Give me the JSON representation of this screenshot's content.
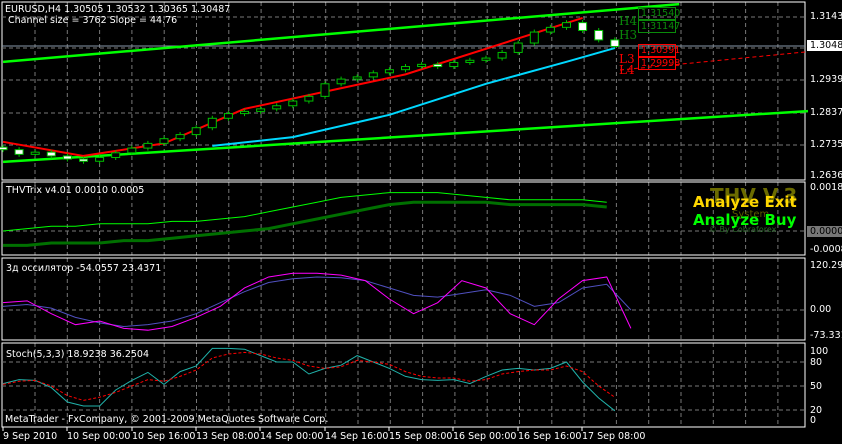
{
  "header": {
    "symbol_line": "EURUSD,H4  1.30505 1.30532 1.30365 1.30487",
    "channel_line": "Channel size = 3762 Slope = 44.76"
  },
  "price_axis": [
    "1.31430",
    "1.29390",
    "1.28370",
    "1.27350",
    "1.26360"
  ],
  "current_price": "1.30487",
  "levels": {
    "boxes": [
      "1.31540",
      "1.31147",
      "1.30391",
      "1.29998"
    ],
    "labels": [
      "H4",
      "H3",
      "L3",
      "L4"
    ]
  },
  "trix": {
    "title": "THVTrix v4.01 0.0010 0.0005",
    "axis": [
      "0.0018",
      "0.0000",
      "-0.0008"
    ],
    "logo": "THV V.3",
    "logo_sub": "System",
    "logo_credit": "© By Cobraforex",
    "signal_exit": "Analyze Exit",
    "signal_buy": "Analyze Buy"
  },
  "osc": {
    "title": "3д оссилятор -54.0557 23.4371",
    "axis": [
      "120.294",
      "0.00",
      "-73.3315"
    ]
  },
  "stoch": {
    "title": "Stoch(5,3,3) 18.9238 36.2504",
    "axis": [
      "100",
      "80",
      "50",
      "20",
      "0"
    ],
    "copyright": "MetaTrader - FxCompany, © 2001-2009 MetaQuotes Software Corp."
  },
  "time_axis": [
    "9 Sep 2010",
    "10 Sep 00:00",
    "10 Sep 16:00",
    "13 Sep 08:00",
    "14 Sep 00:00",
    "14 Sep 16:00",
    "15 Sep 08:00",
    "16 Sep 00:00",
    "16 Sep 16:00",
    "17 Sep 08:00"
  ],
  "colors": {
    "channel": "#00ff00",
    "ma": "#00d8ff",
    "trend": "#ff0000",
    "trix_fast": "#00ff00",
    "trix_slow": "#007000",
    "osc_a": "#ff00ff",
    "osc_b": "#5050c0",
    "stoch_main": "#20b2aa",
    "stoch_signal": "#ff0000"
  },
  "chart_data": [
    {
      "type": "candlestick",
      "title": "EURUSD,H4",
      "ylim": [
        1.2636,
        1.3143
      ],
      "close": [
        1.272,
        1.2705,
        1.2712,
        1.27,
        1.269,
        1.2683,
        1.2695,
        1.271,
        1.2725,
        1.274,
        1.2755,
        1.2768,
        1.279,
        1.282,
        1.2835,
        1.2842,
        1.285,
        1.286,
        1.2875,
        1.289,
        1.293,
        1.2945,
        1.2952,
        1.2965,
        1.2975,
        1.2985,
        1.2992,
        1.2985,
        1.2998,
        1.3005,
        1.3012,
        1.303,
        1.306,
        1.3095,
        1.311,
        1.3125,
        1.31,
        1.307,
        1.3049
      ],
      "channel_upper": [
        [
          0,
          1.3
        ],
        [
          42,
          1.3184
        ]
      ],
      "channel_lower": [
        [
          0,
          1.2681
        ],
        [
          50,
          1.2843
        ]
      ],
      "ma": [
        [
          13,
          1.2732
        ],
        [
          18,
          1.276
        ],
        [
          24,
          1.2831
        ],
        [
          30,
          1.293
        ],
        [
          35,
          1.3
        ],
        [
          38,
          1.3044
        ]
      ],
      "trend": [
        [
          0,
          1.2745
        ],
        [
          5,
          1.27
        ],
        [
          10,
          1.274
        ],
        [
          15,
          1.285
        ],
        [
          25,
          1.296
        ],
        [
          36,
          1.314
        ]
      ]
    },
    {
      "type": "line",
      "title": "THVTrix",
      "ylim": [
        -0.0008,
        0.0018
      ],
      "fast": [
        0.0,
        0.0001,
        0.0002,
        0.0002,
        0.0003,
        0.0003,
        0.0003,
        0.0004,
        0.0004,
        0.0005,
        0.0006,
        0.0008,
        0.001,
        0.0012,
        0.0014,
        0.0015,
        0.0016,
        0.0016,
        0.0016,
        0.0015,
        0.0014,
        0.0013,
        0.0013,
        0.0013,
        0.0013,
        0.0012
      ],
      "slow": [
        -0.0006,
        -0.0006,
        -0.0005,
        -0.0005,
        -0.0005,
        -0.0004,
        -0.0004,
        -0.0003,
        -0.0002,
        -0.0001,
        0.0,
        0.0001,
        0.0003,
        0.0005,
        0.0007,
        0.0009,
        0.0011,
        0.0012,
        0.0012,
        0.0012,
        0.0012,
        0.0011,
        0.0011,
        0.0011,
        0.0011,
        0.001
      ]
    },
    {
      "type": "line",
      "title": "3d oscillator",
      "ylim": [
        -73.3315,
        120.294
      ],
      "a": [
        20,
        25,
        -10,
        -40,
        -30,
        -50,
        -55,
        -45,
        -20,
        10,
        60,
        90,
        100,
        100,
        95,
        80,
        30,
        -10,
        20,
        80,
        60,
        -10,
        -40,
        30,
        80,
        90,
        -50
      ],
      "b": [
        10,
        15,
        5,
        -20,
        -35,
        -45,
        -40,
        -30,
        -10,
        20,
        50,
        75,
        85,
        90,
        88,
        80,
        60,
        40,
        35,
        45,
        55,
        40,
        10,
        20,
        60,
        70,
        0
      ]
    },
    {
      "type": "line",
      "title": "Stoch(5,3,3)",
      "ylim": [
        0,
        100
      ],
      "main": [
        53,
        58,
        57,
        48,
        30,
        25,
        25,
        45,
        57,
        67,
        52,
        68,
        75,
        97,
        97,
        96,
        88,
        80,
        80,
        65,
        72,
        76,
        88,
        80,
        72,
        62,
        58,
        57,
        58,
        53,
        62,
        70,
        72,
        70,
        72,
        80,
        55,
        35,
        19
      ],
      "signal": [
        52,
        56,
        57,
        50,
        38,
        32,
        36,
        42,
        50,
        58,
        56,
        62,
        70,
        85,
        90,
        92,
        90,
        85,
        82,
        75,
        72,
        74,
        82,
        80,
        77,
        68,
        62,
        60,
        60,
        56,
        58,
        65,
        68,
        70,
        70,
        75,
        68,
        50,
        36
      ]
    }
  ]
}
